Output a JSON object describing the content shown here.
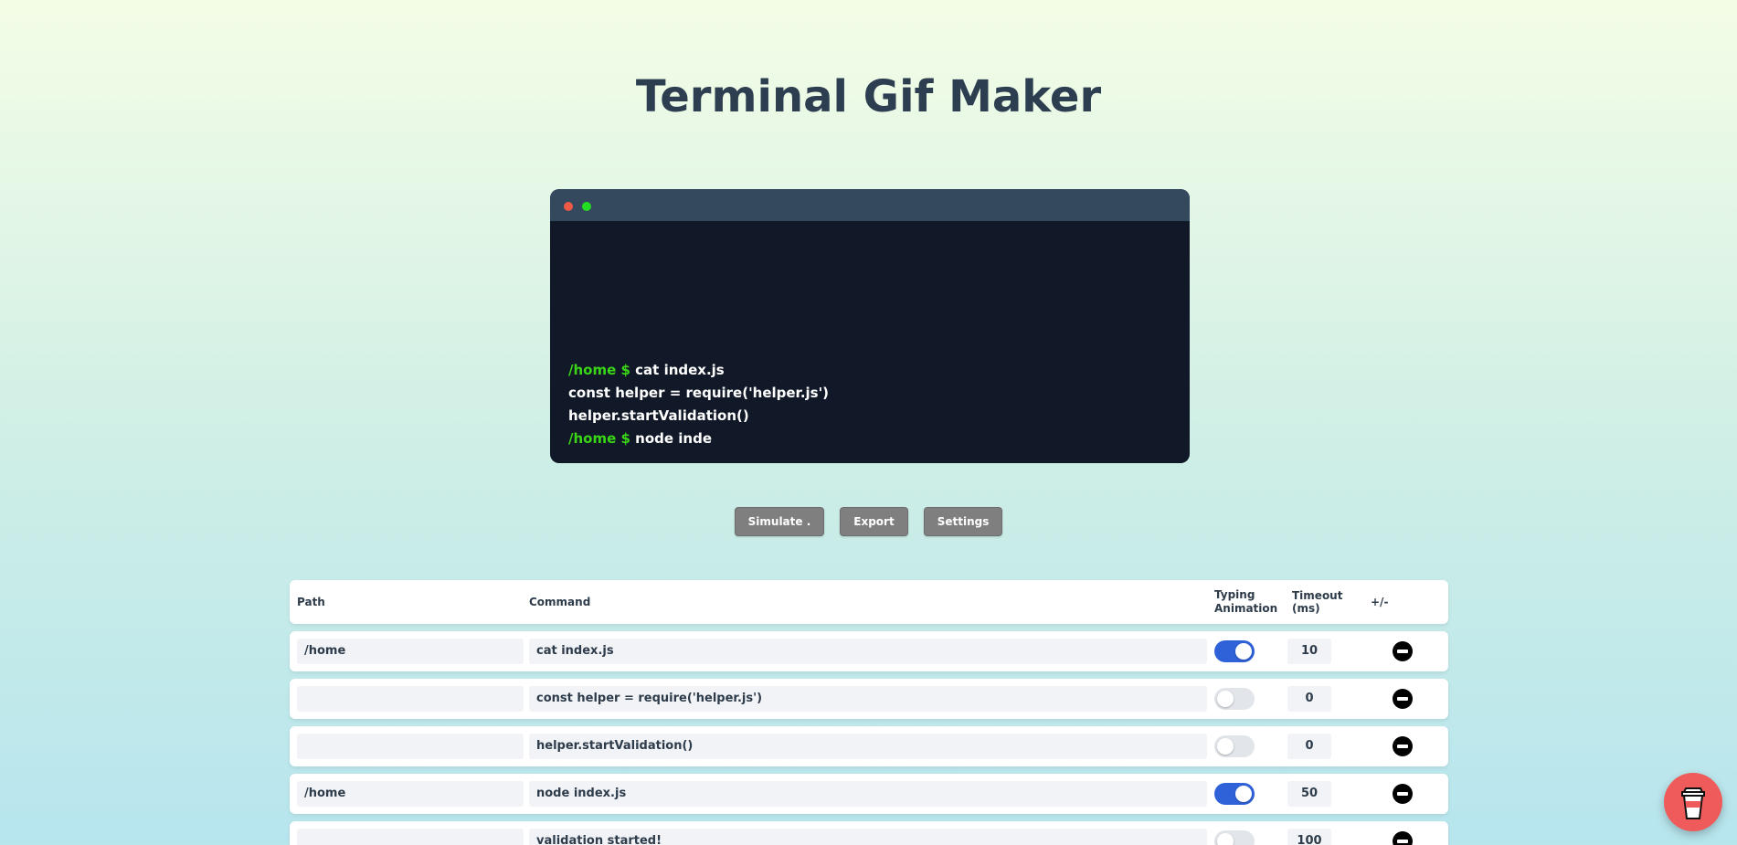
{
  "page": {
    "title": "Terminal Gif Maker"
  },
  "terminal": {
    "lines": [
      {
        "path": "/home $",
        "text": " cat index.js"
      },
      {
        "path": "",
        "text": "const helper = require('helper.js')"
      },
      {
        "path": "",
        "text": "helper.startValidation()"
      },
      {
        "path": "/home $",
        "text": " node inde"
      }
    ]
  },
  "toolbar": {
    "simulate_label": "Simulate .",
    "export_label": "Export",
    "settings_label": "Settings"
  },
  "table": {
    "headers": {
      "path": "Path",
      "command": "Command",
      "typing_line1": "Typing",
      "typing_line2": "Animation",
      "timeout": "Timeout (ms)",
      "add_remove": "+/-"
    },
    "rows": [
      {
        "path": "/home",
        "command": "cat index.js",
        "typing": true,
        "timeout": "10"
      },
      {
        "path": "",
        "command": "const helper = require('helper.js')",
        "typing": false,
        "timeout": "0"
      },
      {
        "path": "",
        "command": "helper.startValidation()",
        "typing": false,
        "timeout": "0"
      },
      {
        "path": "/home",
        "command": "node index.js",
        "typing": true,
        "timeout": "50"
      },
      {
        "path": "",
        "command": "validation started!",
        "typing": false,
        "timeout": "100"
      }
    ]
  },
  "colors": {
    "accent": "#2f62d9",
    "terminal_path": "#39d516",
    "coffee_button": "#ef5b5b"
  },
  "icons": {
    "remove": "minus-circle-icon",
    "coffee": "coffee-cup-icon"
  }
}
